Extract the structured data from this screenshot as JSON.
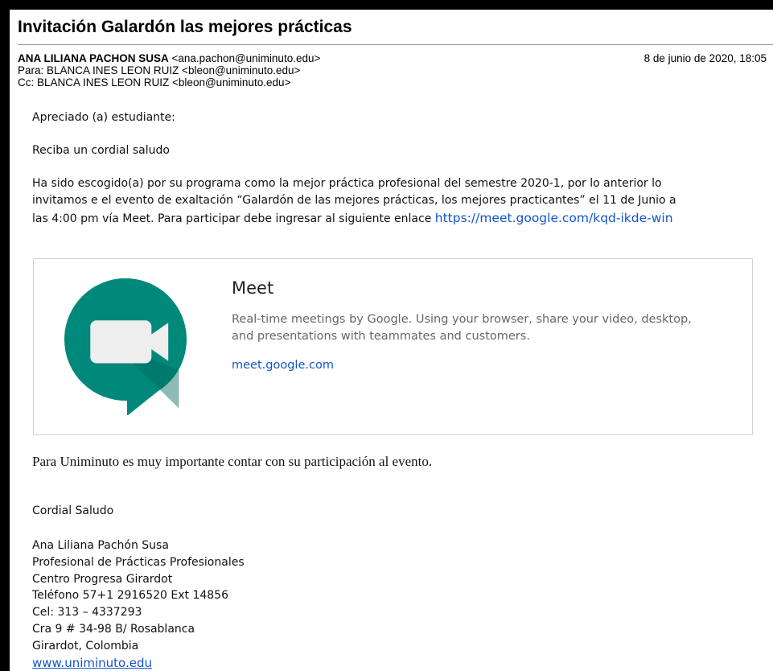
{
  "email": {
    "subject": "Invitación Galardón las mejores prácticas",
    "from_name": "ANA LILIANA PACHON SUSA",
    "from_email": "<ana.pachon@uniminuto.edu>",
    "date": "8 de junio de 2020, 18:05",
    "to": "Para: BLANCA INES LEON RUIZ <bleon@uniminuto.edu>",
    "cc": "Cc: BLANCA INES LEON RUIZ <bleon@uniminuto.edu>"
  },
  "body": {
    "greeting": "Apreciado (a) estudiante:",
    "salutation": "Reciba un cordial saludo",
    "para_line1": "Ha sido escogido(a) por su programa como la mejor práctica profesional del semestre 2020-1, por lo anterior lo",
    "para_line2": "invitamos e el evento de exaltación “Galardón de las mejores prácticas, los mejores practicantes”   el 11 de Junio a",
    "para_line3": "las  4:00 pm vía Meet.  Para participar debe ingresar al siguiente enlace ",
    "meet_link": "https://meet.google.com/kqd-ikde-win",
    "importance": "Para Uniminuto es muy importante  contar con su participación al evento."
  },
  "card": {
    "title": "Meet",
    "description": "Real-time meetings by Google. Using your browser, share your video, desktop, and presentations with teammates and customers.",
    "url": "meet.google.com",
    "logo_icon": "google-meet-logo-icon",
    "logo_color": "#00897b"
  },
  "signature": {
    "closing": "Cordial Saludo",
    "name": "Ana Liliana Pachón Susa",
    "role": "Profesional de Prácticas Profesionales",
    "center": "Centro Progresa Girardot",
    "phone": "Teléfono 57+1 2916520 Ext 14856",
    "cel": "Cel: 313 – 4337293",
    "address": "Cra 9 # 34-98 B/ Rosablanca",
    "city": "Girardot, Colombia",
    "website": "www.uniminuto.edu"
  }
}
